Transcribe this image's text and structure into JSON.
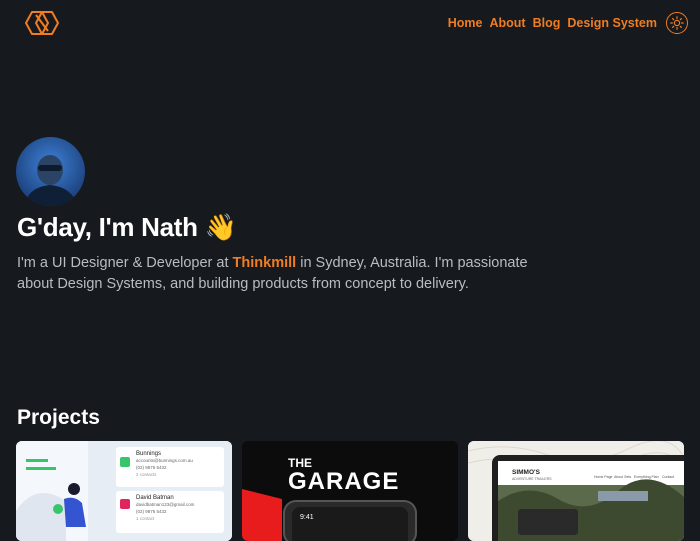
{
  "header": {
    "logo_icon": "hexagon-n-logo-icon",
    "nav": [
      {
        "label": "Home"
      },
      {
        "label": "About"
      },
      {
        "label": "Blog"
      },
      {
        "label": "Design System"
      }
    ],
    "theme_toggle_icon": "sun-icon"
  },
  "hero": {
    "avatar_icon": "avatar-photo",
    "headline": "G'day, I'm Nath 👋",
    "intro_before": "I'm a UI Designer & Developer at ",
    "intro_company": "Thinkmill",
    "intro_after": " in Sydney, Australia. I'm passionate about Design Systems, and building products from concept to delivery."
  },
  "projects": {
    "title": "Projects",
    "cards": [
      {
        "name": "bunnings-contacts",
        "contact1_name": "Bunnings",
        "contact1_email": "accounts@bunnings.com.au",
        "contact1_phone": "(02) 9876 5432",
        "contact1_sub": "2 contacts",
        "contact2_name": "David Batman",
        "contact2_email": "davidbatman123@gmail.com",
        "contact2_phone": "(02) 9876 5432",
        "contact2_sub": "1 contact"
      },
      {
        "name": "the-garage",
        "brand_top": "THE",
        "brand_main": "GARAGE",
        "phone_time": "9:41"
      },
      {
        "name": "simmos",
        "site_title": "SIMMO'S",
        "site_sub": "ADVENTURE TRAILERS",
        "nav_items": [
          "Home Page",
          "About Sets",
          "Everything Plan",
          "Contact"
        ]
      }
    ]
  },
  "colors": {
    "background": "#16191e",
    "accent": "#ef7d22",
    "text_muted": "#b9bdc3"
  }
}
